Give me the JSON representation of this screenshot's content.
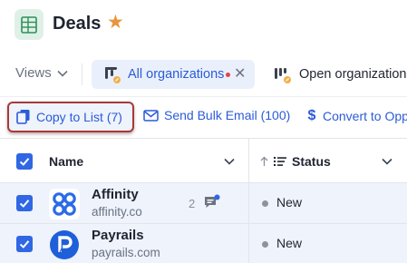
{
  "header": {
    "title": "Deals",
    "icon": "spreadsheet-icon",
    "favorite_icon": "star-icon",
    "colors": {
      "star": "#e7963d",
      "app_icon_bg": "#dff1e6",
      "app_icon_fg": "#2f8f5b"
    }
  },
  "views": {
    "dropdown_label": "Views",
    "tabs": [
      {
        "label": "All organizations",
        "active": true,
        "unsaved_dot": true,
        "icon": "pinned-view-icon"
      },
      {
        "label": "Open organizations",
        "active": false,
        "icon": "pinned-view-icon"
      }
    ]
  },
  "toolbar": {
    "copy_label": "Copy to List (7)",
    "email_label": "Send Bulk Email (100)",
    "convert_label": "Convert to Opp"
  },
  "table": {
    "columns": [
      {
        "label": "Name"
      },
      {
        "label": "Status",
        "sort_icon": "arrow-up-icon",
        "type_icon": "list-icon"
      }
    ],
    "rows": [
      {
        "name": "Affinity",
        "domain": "affinity.co",
        "comment_count": "2",
        "status": "New",
        "logo": "affinity-logo"
      },
      {
        "name": "Payrails",
        "domain": "payrails.com",
        "status": "New",
        "logo": "payrails-logo"
      }
    ]
  },
  "colors": {
    "accent": "#2a5bd7",
    "checkbox": "#2f67e4",
    "row_selected": "#eef3fc",
    "highlight_border": "#a63a3a"
  }
}
